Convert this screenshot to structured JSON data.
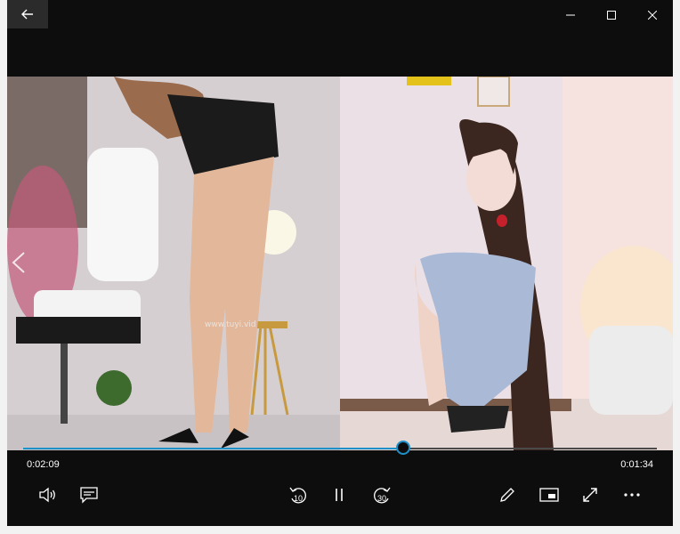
{
  "titlebar": {
    "back_icon": "arrow-left-icon",
    "window_buttons": [
      "minimize-icon",
      "maximize-icon",
      "close-icon"
    ]
  },
  "video": {
    "watermark": "www.tuyi.vid",
    "prev_icon": "chevron-left-icon"
  },
  "playback": {
    "progress_fraction": 0.6,
    "elapsed": "0:02:09",
    "remaining": "0:01:34"
  },
  "controls": {
    "left": [
      "volume-icon",
      "subtitles-icon"
    ],
    "center": {
      "skip_back_label": "10",
      "play_pause_icon": "pause-icon",
      "skip_forward_label": "30"
    },
    "right": [
      "edit-pen-icon",
      "mini-view-icon",
      "fullscreen-icon",
      "more-icon"
    ]
  },
  "colors": {
    "accent": "#1e90c8",
    "background": "#0d0d0d"
  }
}
